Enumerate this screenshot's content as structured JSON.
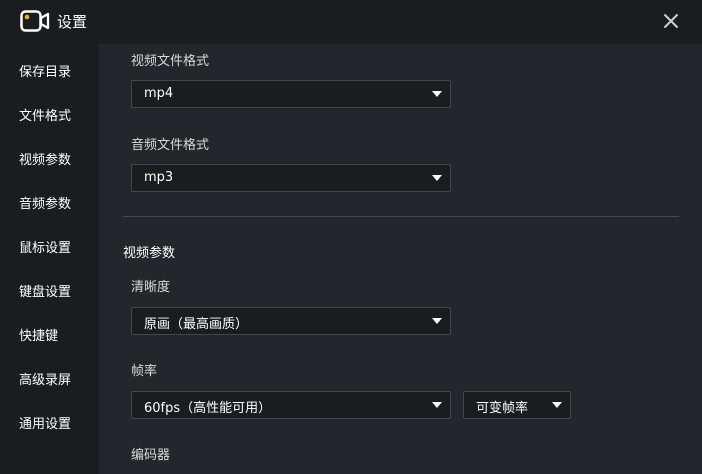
{
  "window": {
    "title": "设置",
    "icon": "video-camera-icon",
    "close_icon": "close-icon"
  },
  "sidebar": {
    "items": [
      {
        "label": "保存目录"
      },
      {
        "label": "文件格式"
      },
      {
        "label": "视频参数"
      },
      {
        "label": "音频参数"
      },
      {
        "label": "鼠标设置"
      },
      {
        "label": "键盘设置"
      },
      {
        "label": "快捷键"
      },
      {
        "label": "高级录屏"
      },
      {
        "label": "通用设置"
      }
    ]
  },
  "file_format": {
    "video_label": "视频文件格式",
    "video_value": "mp4",
    "audio_label": "音频文件格式",
    "audio_value": "mp3"
  },
  "video_params": {
    "section_title": "视频参数",
    "clarity_label": "清晰度",
    "clarity_value": "原画（最高画质）",
    "framerate_label": "帧率",
    "framerate_value": "60fps（高性能可用）",
    "framerate_mode_value": "可变帧率",
    "encoder_label": "编码器"
  },
  "colors": {
    "accent": "#f5b800",
    "sidebar_bg": "#1b1c20",
    "content_bg": "#25262b",
    "input_border": "#45464b"
  }
}
